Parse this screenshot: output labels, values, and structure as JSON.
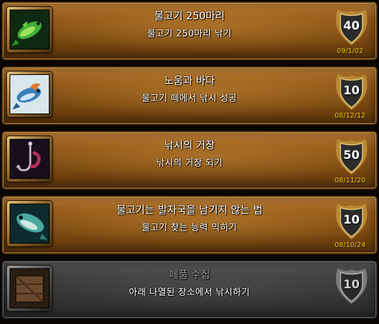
{
  "achievements": [
    {
      "title": "물고기 250마리",
      "description": "물고기 250마리 낚기",
      "points": "40",
      "date": "09/1/02",
      "icon": "green-fish-icon",
      "completed": true
    },
    {
      "title": "노움과 바다",
      "description": "물고기 떼에서 낚시 성공",
      "points": "10",
      "date": "08/12/12",
      "icon": "blue-fish-icon",
      "completed": true
    },
    {
      "title": "낚시의 거장",
      "description": "낚시의 거장 되기",
      "points": "50",
      "date": "08/11/20",
      "icon": "fishing-hook-icon",
      "completed": true
    },
    {
      "title": "물고기는 발자국을 남기지 않는 법",
      "description": "물고기 찾는 능력 익히기",
      "points": "10",
      "date": "08/10/24",
      "icon": "tuna-fish-icon",
      "completed": true
    },
    {
      "title": "페품 수집",
      "description": "아래 나열된 장소에서 낚시하기",
      "points": "10",
      "date": "",
      "icon": "wooden-crate-icon",
      "completed": false
    }
  ]
}
